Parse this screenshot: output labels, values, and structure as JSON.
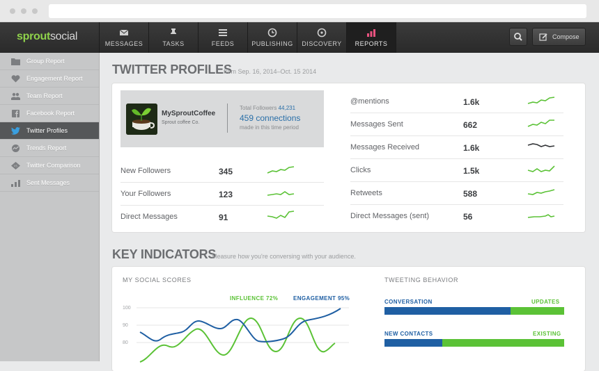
{
  "brand": {
    "part1": "sprout",
    "part2": "social"
  },
  "nav": [
    {
      "label": "MESSAGES",
      "icon": "envelope-icon"
    },
    {
      "label": "TASKS",
      "icon": "pin-icon"
    },
    {
      "label": "FEEDS",
      "icon": "list-icon"
    },
    {
      "label": "PUBLISHING",
      "icon": "clock-icon"
    },
    {
      "label": "DISCOVERY",
      "icon": "compass-icon"
    },
    {
      "label": "REPORTS",
      "icon": "bar-chart-icon",
      "active": true
    }
  ],
  "toolbar": {
    "compose_label": "Compose"
  },
  "sidebar": [
    {
      "label": "Group Report",
      "icon": "folder-icon"
    },
    {
      "label": "Engagement Report",
      "icon": "heart-icon"
    },
    {
      "label": "Team Report",
      "icon": "people-icon"
    },
    {
      "label": "Facebook Report",
      "icon": "facebook-icon"
    },
    {
      "label": "Twitter Profiles",
      "icon": "twitter-icon",
      "active": true
    },
    {
      "label": "Trends Report",
      "icon": "trend-icon"
    },
    {
      "label": "Twitter Comparison",
      "icon": "versus-icon"
    },
    {
      "label": "Sent Messages",
      "icon": "bars-icon"
    }
  ],
  "profiles": {
    "title": "TWITTER PROFILES",
    "date_range": "from Sep. 16, 2014–Oct. 15 2014",
    "profile_name": "MySproutCoffee",
    "profile_desc": "Sprout coffee Co.",
    "total_followers_label": "Total Followers",
    "total_followers_value": "44,231",
    "connections": "459 connections",
    "made_in_period": "made in this time period",
    "left_metrics": [
      {
        "label": "New Followers",
        "value": "345"
      },
      {
        "label": "Your Followers",
        "value": "123"
      },
      {
        "label": "Direct Messages",
        "value": "91"
      }
    ],
    "right_metrics": [
      {
        "label": "@mentions",
        "value": "1.6k"
      },
      {
        "label": "Messages Sent",
        "value": "662"
      },
      {
        "label": "Messages Received",
        "value": "1.6k"
      },
      {
        "label": "Clicks",
        "value": "1.5k"
      },
      {
        "label": "Retweets",
        "value": "588"
      },
      {
        "label": "Direct Messages (sent)",
        "value": "56"
      }
    ]
  },
  "key_indicators": {
    "title": "KEY INDICATORS",
    "subtitle": "Measure how you're conversing with your audience.",
    "scores_title": "MY SOCIAL SCORES",
    "influence_legend": "INFLUENCE 72%",
    "engagement_legend": "ENGAGEMENT 95%",
    "y_ticks": [
      "100",
      "90",
      "80"
    ],
    "behavior_title": "TWEETING BEHAVIOR",
    "conversation_label": "CONVERSATION",
    "updates_label": "UPDATES",
    "conversation_fraction": 0.7,
    "new_contacts_label": "NEW CONTACTS",
    "existing_label": "EXISTING",
    "new_contacts_fraction": 0.32
  },
  "colors": {
    "green": "#5bc236",
    "blue": "#1f5fa3",
    "active_pink": "#e8527f"
  }
}
